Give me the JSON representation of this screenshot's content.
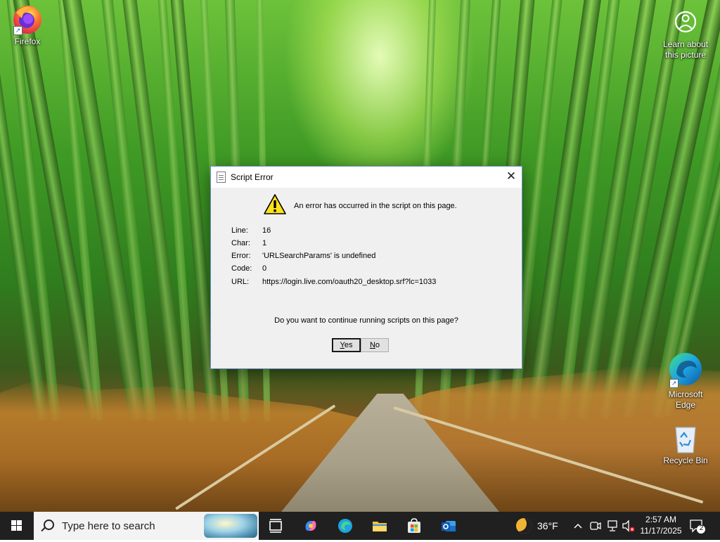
{
  "desktop": {
    "icons": {
      "firefox": "Firefox",
      "learn_line1": "Learn about",
      "learn_line2": "this picture",
      "edge_line1": "Microsoft",
      "edge_line2": "Edge",
      "recycle": "Recycle Bin"
    }
  },
  "dialog": {
    "title": "Script Error",
    "close_glyph": "✕",
    "message": "An error has occurred in the script on this page.",
    "details": [
      {
        "label": "Line:",
        "value": "16"
      },
      {
        "label": "Char:",
        "value": "1"
      },
      {
        "label": "Error:",
        "value": "'URLSearchParams' is undefined"
      },
      {
        "label": "Code:",
        "value": "0"
      },
      {
        "label": "URL:",
        "value": "https://login.live.com/oauth20_desktop.srf?lc=1033"
      }
    ],
    "question": "Do you want to continue running scripts on this page?",
    "yes_label": "Yes",
    "no_label": "No"
  },
  "taskbar": {
    "search_placeholder": "Type here to search",
    "weather_temp": "36°F",
    "time": "2:57 AM",
    "date": "11/17/2025",
    "notification_count": "2"
  },
  "colors": {
    "taskbar_bg": "#202020",
    "dialog_bg": "#f0f0f0",
    "accent": "#0078d4"
  }
}
